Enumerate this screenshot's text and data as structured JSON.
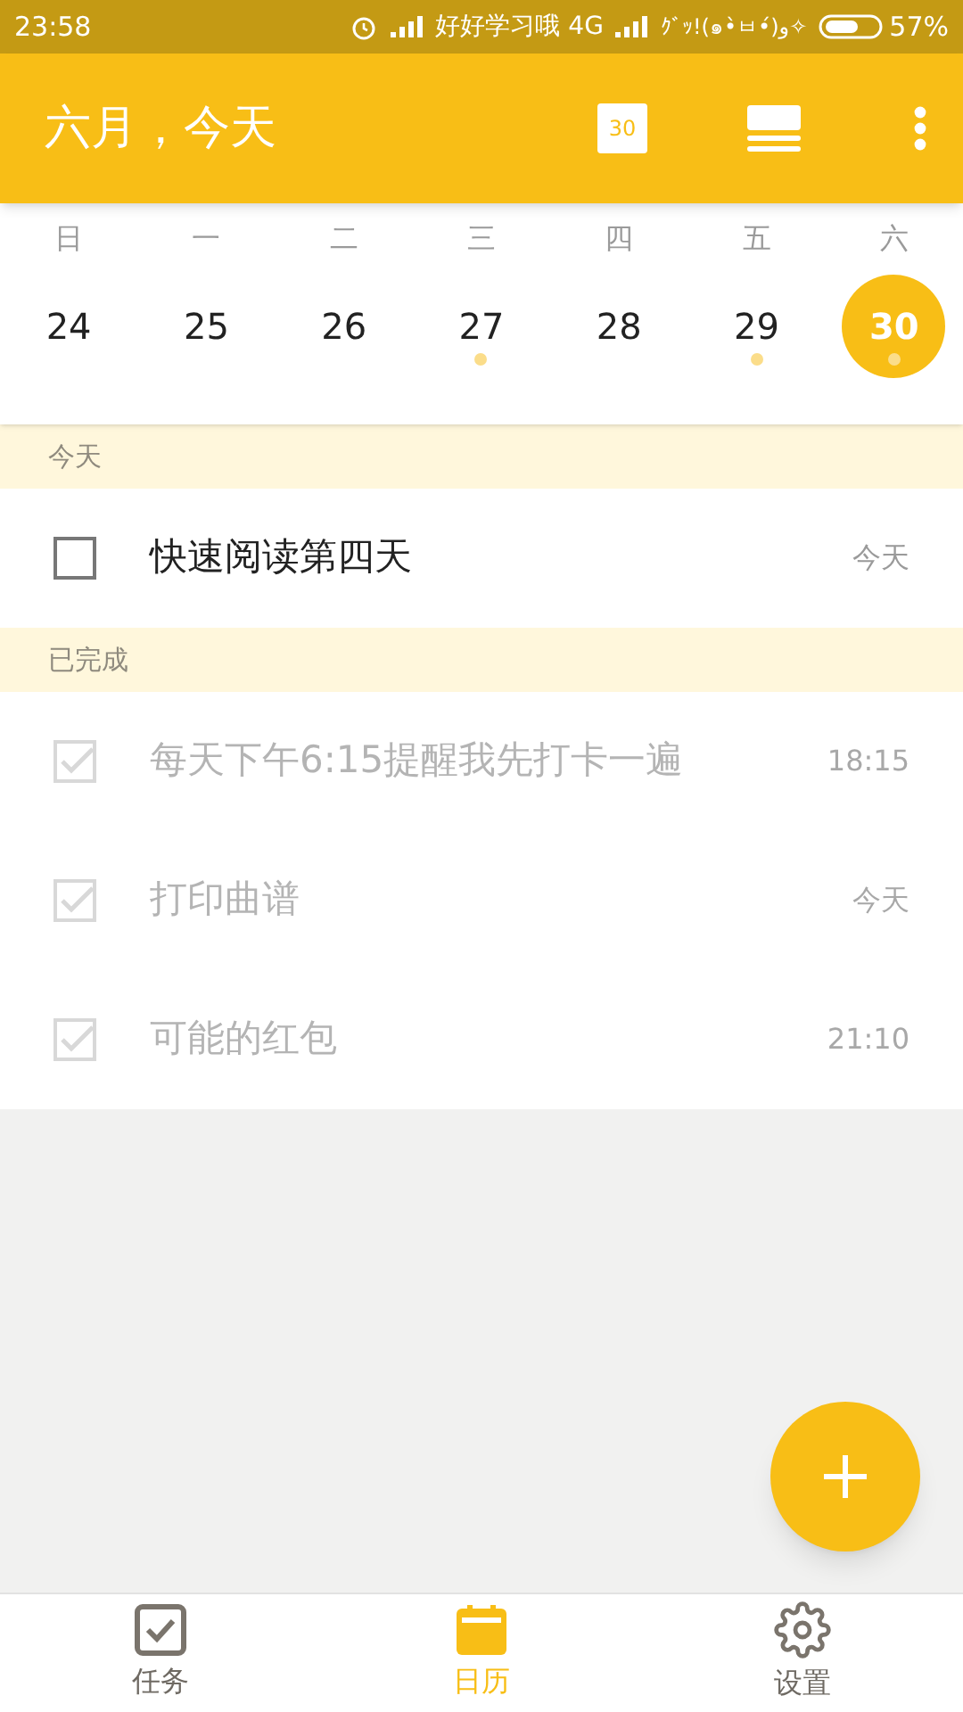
{
  "status_bar": {
    "time": "23:58",
    "carrier_1": "好好学习哦 4G",
    "carrier_2": "ｸﾞｯ!(๑•̀ㅂ•́)و✧",
    "battery": "57%"
  },
  "header": {
    "title": "六月，今天",
    "calendar_badge": "30"
  },
  "weekdays": [
    "日",
    "一",
    "二",
    "三",
    "四",
    "五",
    "六"
  ],
  "days": [
    {
      "label": "24",
      "has_event": false,
      "selected": false
    },
    {
      "label": "25",
      "has_event": false,
      "selected": false
    },
    {
      "label": "26",
      "has_event": false,
      "selected": false
    },
    {
      "label": "27",
      "has_event": true,
      "selected": false
    },
    {
      "label": "28",
      "has_event": false,
      "selected": false
    },
    {
      "label": "29",
      "has_event": true,
      "selected": false
    },
    {
      "label": "30",
      "has_event": true,
      "selected": true
    }
  ],
  "sections": [
    {
      "title": "今天",
      "tasks": [
        {
          "title": "快速阅读第四天",
          "time": "今天",
          "checked": false
        }
      ]
    },
    {
      "title": "已完成",
      "tasks": [
        {
          "title": "每天下午6:15提醒我先打卡一遍",
          "time": "18:15",
          "checked": true
        },
        {
          "title": "打印曲谱",
          "time": "今天",
          "checked": true
        },
        {
          "title": "可能的红包",
          "time": "21:10",
          "checked": true
        }
      ]
    }
  ],
  "bottom_nav": [
    {
      "label": "任务",
      "kind": "tasks",
      "selected": false
    },
    {
      "label": "日历",
      "kind": "calendar",
      "selected": true
    },
    {
      "label": "设置",
      "kind": "settings",
      "selected": false
    }
  ]
}
